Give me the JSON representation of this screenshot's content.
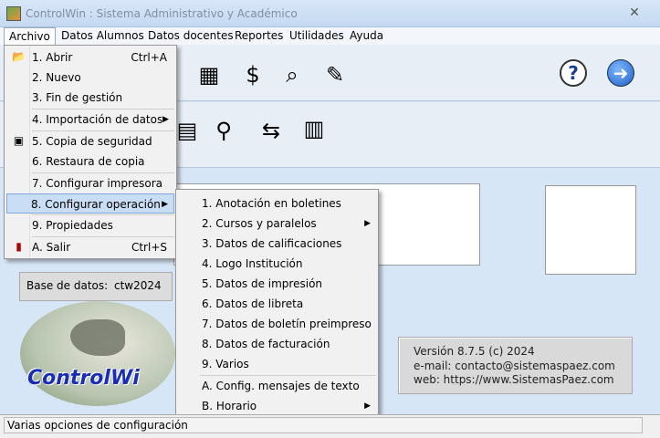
{
  "window": {
    "title": "ControlWin : Sistema Administrativo y Académico",
    "close_glyph": "✕"
  },
  "menubar": [
    {
      "label": "Archivo"
    },
    {
      "label": "Datos Alumnos"
    },
    {
      "label": "Datos docentes"
    },
    {
      "label": "Reportes"
    },
    {
      "label": "Utilidades"
    },
    {
      "label": "Ayuda"
    }
  ],
  "archivo_menu": [
    {
      "label": "1. Abrir",
      "shortcut": "Ctrl+A",
      "icon": "folder-icon"
    },
    {
      "label": "2. Nuevo"
    },
    {
      "label": "3. Fin de gestión"
    },
    {
      "label": "4. Importación de datos",
      "submenu": true
    },
    {
      "label": "5. Copia de seguridad",
      "icon": "floppy-icon"
    },
    {
      "label": "6. Restaura de copia"
    },
    {
      "label": "7. Configurar impresora"
    },
    {
      "label": "8. Configurar operación",
      "submenu": true,
      "highlighted": true
    },
    {
      "label": "9. Propiedades"
    },
    {
      "label": "A. Salir",
      "shortcut": "Ctrl+S",
      "icon": "exit-icon"
    }
  ],
  "config_submenu": [
    {
      "label": "1. Anotación en boletines"
    },
    {
      "label": "2. Cursos y paralelos",
      "submenu": true
    },
    {
      "label": "3. Datos de calificaciones"
    },
    {
      "label": "4. Logo Institución"
    },
    {
      "label": "5. Datos de impresión"
    },
    {
      "label": "6. Datos de libreta"
    },
    {
      "label": "7. Datos de boletín preimpreso"
    },
    {
      "label": "8. Datos de facturación"
    },
    {
      "label": "9. Varios"
    },
    {
      "label": "A. Config. mensajes de texto"
    },
    {
      "label": "B. Horario",
      "submenu": true
    }
  ],
  "database": {
    "label": "Base de datos:",
    "value": "ctw2024"
  },
  "logo": {
    "text": "ControlWi"
  },
  "info": {
    "version": "Versión 8.7.5  (c) 2024",
    "email": "e-mail: contacto@sistemaspaez.com",
    "web": "web: https://www.SistemasPaez.com"
  },
  "status": {
    "text": "Varias opciones de configuración"
  },
  "colors": {
    "accent": "#c9def5",
    "logo_text": "#1a2db5"
  }
}
